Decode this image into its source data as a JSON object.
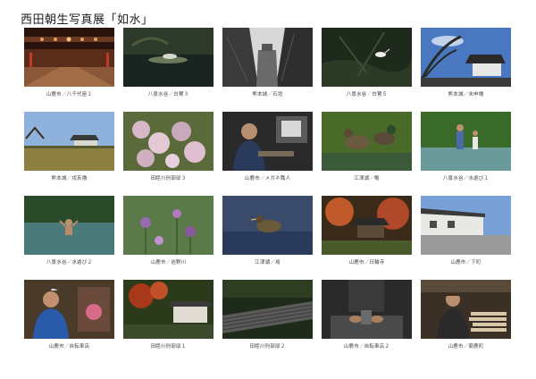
{
  "title": "西田朝生写真展「如水」",
  "photos": [
    {
      "caption": "山鹿市／八千代座１",
      "icon": "theater-interior"
    },
    {
      "caption": "八景水谷／白鷺３",
      "icon": "heron-pond"
    },
    {
      "caption": "熊本城／石垣",
      "icon": "castle-stone-wall"
    },
    {
      "caption": "八景水谷／白鷺５",
      "icon": "heron-bush"
    },
    {
      "caption": "熊本城／未申櫓",
      "icon": "castle-turret"
    },
    {
      "caption": "熊本城／戌亥櫓",
      "icon": "castle-field"
    },
    {
      "caption": "田睦川刑部邸３",
      "icon": "flowers"
    },
    {
      "caption": "山鹿市／メガネ職人",
      "icon": "craftsman"
    },
    {
      "caption": "江津湖／鴨",
      "icon": "ducks"
    },
    {
      "caption": "八景水谷／水遊び１",
      "icon": "children-water"
    },
    {
      "caption": "八景水谷／水遊び２",
      "icon": "child-swimming"
    },
    {
      "caption": "山鹿市／岩野川",
      "icon": "riverside-flowers"
    },
    {
      "caption": "江津湖／鳰",
      "icon": "grebe"
    },
    {
      "caption": "山鹿市／日輪寺",
      "icon": "temple-autumn"
    },
    {
      "caption": "山鹿市／下町",
      "icon": "old-street"
    },
    {
      "caption": "山鹿市／自転車店",
      "icon": "bicycle-shopkeeper"
    },
    {
      "caption": "田睦川刑部邸１",
      "icon": "garden-house"
    },
    {
      "caption": "田睦川刑部邸２",
      "icon": "tiled-roof"
    },
    {
      "caption": "山鹿市／自転車店２",
      "icon": "workshop-hands"
    },
    {
      "caption": "山鹿市／菊鹿町",
      "icon": "woman-firewood"
    }
  ]
}
